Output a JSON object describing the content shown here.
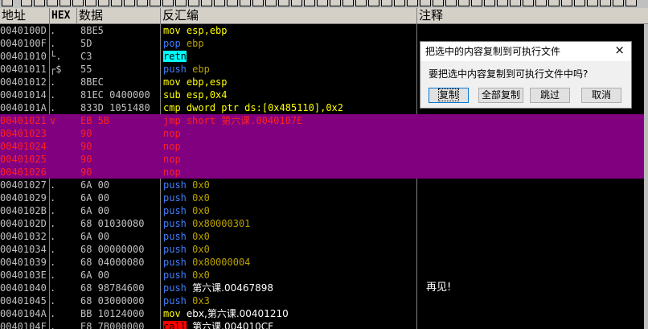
{
  "header": {
    "address": "地址",
    "hex": "HEX",
    "data": "数据",
    "disassembly": "反汇编",
    "comment": "注释"
  },
  "colors": {
    "selection": "#800080",
    "mnemonic": "#ffff00",
    "push": "#3f7fff",
    "call_bg": "#ff0000",
    "ret_bg": "#00ffff"
  },
  "rows": [
    {
      "addr": "0040100D",
      "tree": " .",
      "hex": "8BE5",
      "mn": "mov",
      "ops": "esp,ebp",
      "kind": "norm",
      "cmt": ""
    },
    {
      "addr": "0040100F",
      "tree": " .",
      "hex": "5D",
      "mn": "pop",
      "ops": "ebp",
      "kind": "push",
      "cmt": ""
    },
    {
      "addr": "00401010",
      "tree": "└.",
      "hex": "C3",
      "mn": "retn",
      "ops": "",
      "kind": "ret",
      "cmt": ""
    },
    {
      "addr": "00401011",
      "tree": "┌$",
      "hex": "55",
      "mn": "push",
      "ops": "ebp",
      "kind": "push",
      "cmt": ""
    },
    {
      "addr": "00401012",
      "tree": " .",
      "hex": "8BEC",
      "mn": "mov",
      "ops": "ebp,esp",
      "kind": "norm",
      "cmt": ""
    },
    {
      "addr": "00401014",
      "tree": " .",
      "hex": "81EC 0400000",
      "mn": "sub",
      "ops": "esp,0x4",
      "kind": "norm",
      "cmt": ""
    },
    {
      "addr": "0040101A",
      "tree": " .",
      "hex": "833D 1051480",
      "mn": "cmp",
      "ops": "dword ptr ds:[0x485110],0x2",
      "kind": "norm",
      "cmt": ""
    },
    {
      "addr": "00401021",
      "tree": " v",
      "hex": "EB 5B",
      "mn": "jmp",
      "ops": "short 第六课.0040107E",
      "kind": "jmp",
      "sel": true,
      "cmt": ""
    },
    {
      "addr": "00401023",
      "tree": "",
      "hex": "90",
      "mn": "nop",
      "ops": "",
      "kind": "nop",
      "sel": true,
      "cmt": ""
    },
    {
      "addr": "00401024",
      "tree": "",
      "hex": "90",
      "mn": "nop",
      "ops": "",
      "kind": "nop",
      "sel": true,
      "cmt": ""
    },
    {
      "addr": "00401025",
      "tree": "",
      "hex": "90",
      "mn": "nop",
      "ops": "",
      "kind": "nop",
      "sel": true,
      "cmt": ""
    },
    {
      "addr": "00401026",
      "tree": "",
      "hex": "90",
      "mn": "nop",
      "ops": "",
      "kind": "nop",
      "sel": true,
      "cmt": ""
    },
    {
      "addr": "00401027",
      "tree": " .",
      "hex": "6A 00",
      "mn": "push",
      "ops": "0x0",
      "kind": "push",
      "cmt": ""
    },
    {
      "addr": "00401029",
      "tree": " .",
      "hex": "6A 00",
      "mn": "push",
      "ops": "0x0",
      "kind": "push",
      "cmt": ""
    },
    {
      "addr": "0040102B",
      "tree": " .",
      "hex": "6A 00",
      "mn": "push",
      "ops": "0x0",
      "kind": "push",
      "cmt": ""
    },
    {
      "addr": "0040102D",
      "tree": " .",
      "hex": "68 01030080",
      "mn": "push",
      "ops": "0x80000301",
      "kind": "push",
      "cmt": ""
    },
    {
      "addr": "00401032",
      "tree": " .",
      "hex": "6A 00",
      "mn": "push",
      "ops": "0x0",
      "kind": "push",
      "cmt": ""
    },
    {
      "addr": "00401034",
      "tree": " .",
      "hex": "68 00000000",
      "mn": "push",
      "ops": "0x0",
      "kind": "push",
      "cmt": ""
    },
    {
      "addr": "00401039",
      "tree": " .",
      "hex": "68 04000080",
      "mn": "push",
      "ops": "0x80000004",
      "kind": "push",
      "cmt": ""
    },
    {
      "addr": "0040103E",
      "tree": " .",
      "hex": "6A 00",
      "mn": "push",
      "ops": "0x0",
      "kind": "push",
      "cmt": ""
    },
    {
      "addr": "00401040",
      "tree": " .",
      "hex": "68 98784600",
      "mn": "push",
      "ops": "第六课.00467898",
      "kind": "pushw",
      "cmt": "再见!"
    },
    {
      "addr": "00401045",
      "tree": " .",
      "hex": "68 03000000",
      "mn": "push",
      "ops": "0x3",
      "kind": "push",
      "cmt": ""
    },
    {
      "addr": "0040104A",
      "tree": " .",
      "hex": "BB 10124000",
      "mn": "mov",
      "ops": "ebx,第六课.00401210",
      "kind": "movw",
      "cmt": ""
    },
    {
      "addr": "0040104F",
      "tree": " .",
      "hex": "E8 7B000000",
      "mn": "call",
      "ops": "第六课.004010CF",
      "kind": "call",
      "cmt": ""
    }
  ],
  "dialog": {
    "title": "把选中的内容复制到可执行文件",
    "close": "×",
    "message": "要把选中内容复制到可执行文件中吗?",
    "buttons": [
      "复制",
      "全部复制",
      "跳过",
      "取消"
    ]
  }
}
